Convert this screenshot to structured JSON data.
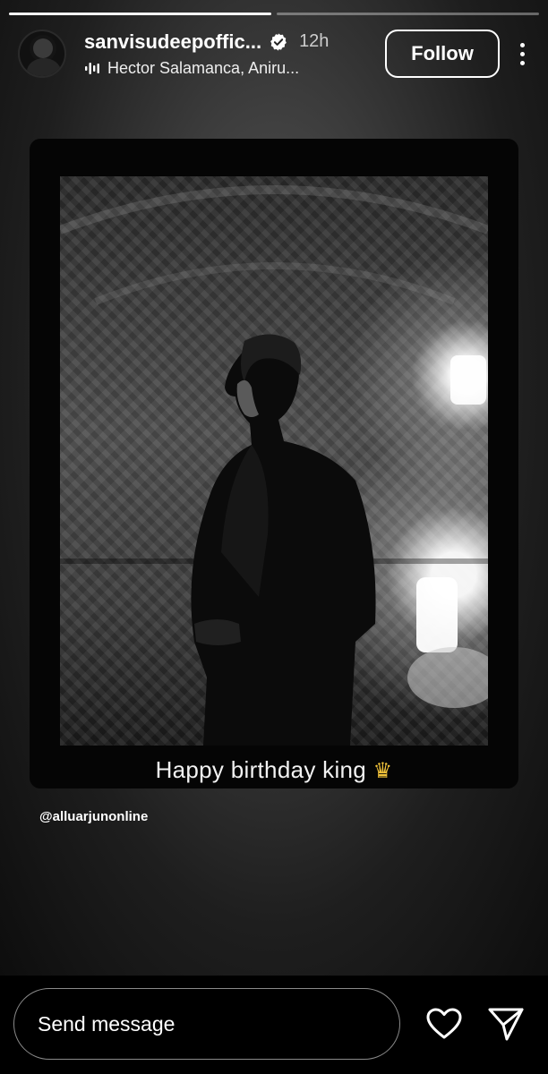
{
  "progress": {
    "segments": [
      {
        "filled": 1.0
      },
      {
        "filled": 0.0
      }
    ]
  },
  "header": {
    "username": "sanvisudeepoffic...",
    "time": "12h",
    "song": "Hector Salamanca, Aniru...",
    "follow_label": "Follow"
  },
  "post": {
    "caption_text": "Happy birthday king",
    "mention": "@alluarjunonline"
  },
  "footer": {
    "message_placeholder": "Send message"
  },
  "icons": {
    "verified": "verified-badge-icon",
    "music": "audio-wave-icon",
    "more": "more-vertical-icon",
    "crown": "crown-icon",
    "like": "heart-icon",
    "send": "paper-plane-icon"
  },
  "colors": {
    "background": "#000000",
    "accent": "#ffffff",
    "crown": "#f2c33a"
  }
}
